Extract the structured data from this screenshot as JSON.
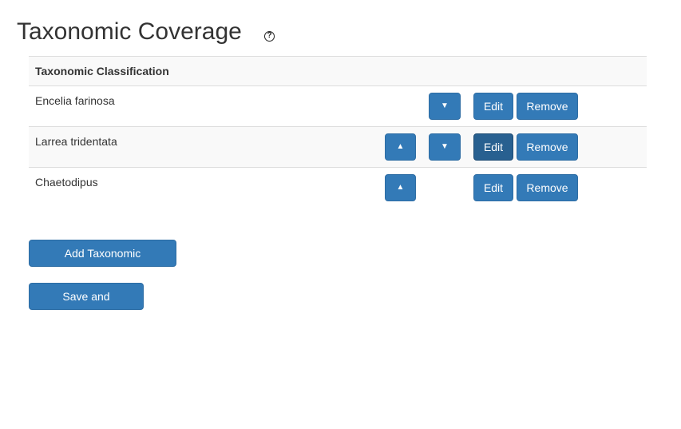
{
  "page": {
    "title": "Taxonomic Coverage",
    "help_icon": "?"
  },
  "table": {
    "header": "Taxonomic Classification",
    "rows": [
      {
        "name": "Encelia farinosa",
        "up": null,
        "down": "▼",
        "edit": "Edit",
        "remove": "Remove"
      },
      {
        "name": "Larrea tridentata",
        "up": "▲",
        "down": "▼",
        "edit": "Edit",
        "remove": "Remove"
      },
      {
        "name": "Chaetodipus",
        "up": "▲",
        "down": null,
        "edit": "Edit",
        "remove": "Remove"
      }
    ]
  },
  "actions": {
    "add_label": "Add Taxonomic Coverage",
    "save_label": "Save and Continue"
  },
  "colors": {
    "primary": "#337ab7",
    "primary_active": "#286090",
    "stripe": "#f9f9f9",
    "border": "#dddddd"
  }
}
